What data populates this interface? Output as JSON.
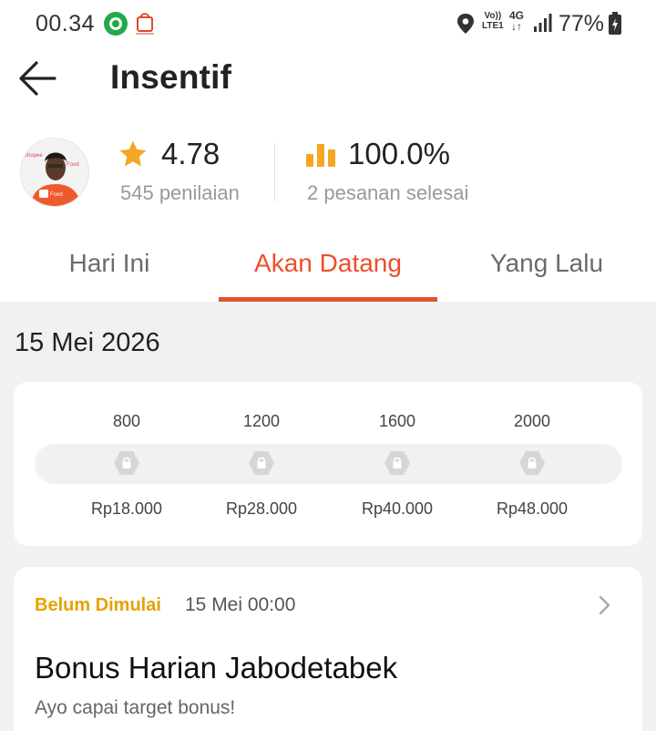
{
  "status_bar": {
    "time": "00.34",
    "volte_top": "Vo))",
    "volte_bottom": "LTE1",
    "network": "4G",
    "network_arrows": "↓↑",
    "battery": "77%"
  },
  "header": {
    "title": "Insentif"
  },
  "profile": {
    "rating": "4.78",
    "rating_count": "545 penilaian",
    "completion": "100.0%",
    "completion_label": "2 pesanan selesai"
  },
  "tabs": [
    {
      "label": "Hari Ini",
      "active": false
    },
    {
      "label": "Akan Datang",
      "active": true
    },
    {
      "label": "Yang Lalu",
      "active": false
    }
  ],
  "date_heading": "15 Mei 2026",
  "milestones": [
    {
      "target": "800",
      "reward": "Rp18.000",
      "locked": true
    },
    {
      "target": "1200",
      "reward": "Rp28.000",
      "locked": true
    },
    {
      "target": "1600",
      "reward": "Rp40.000",
      "locked": true
    },
    {
      "target": "2000",
      "reward": "Rp48.000",
      "locked": true
    }
  ],
  "bonus": {
    "status": "Belum Dimulai",
    "start": "15 Mei 00:00",
    "title": "Bonus Harian Jabodetabek",
    "subtitle": "Ayo capai target bonus!"
  },
  "colors": {
    "accent": "#ee4d2d",
    "star": "#f5a623",
    "pending": "#e8a100",
    "page_bg": "#f1f1f1"
  },
  "icons": [
    "back-arrow-icon",
    "star-icon",
    "bar-chart-icon",
    "lock-icon",
    "chevron-right-icon",
    "location-icon",
    "signal-icon",
    "battery-icon"
  ]
}
